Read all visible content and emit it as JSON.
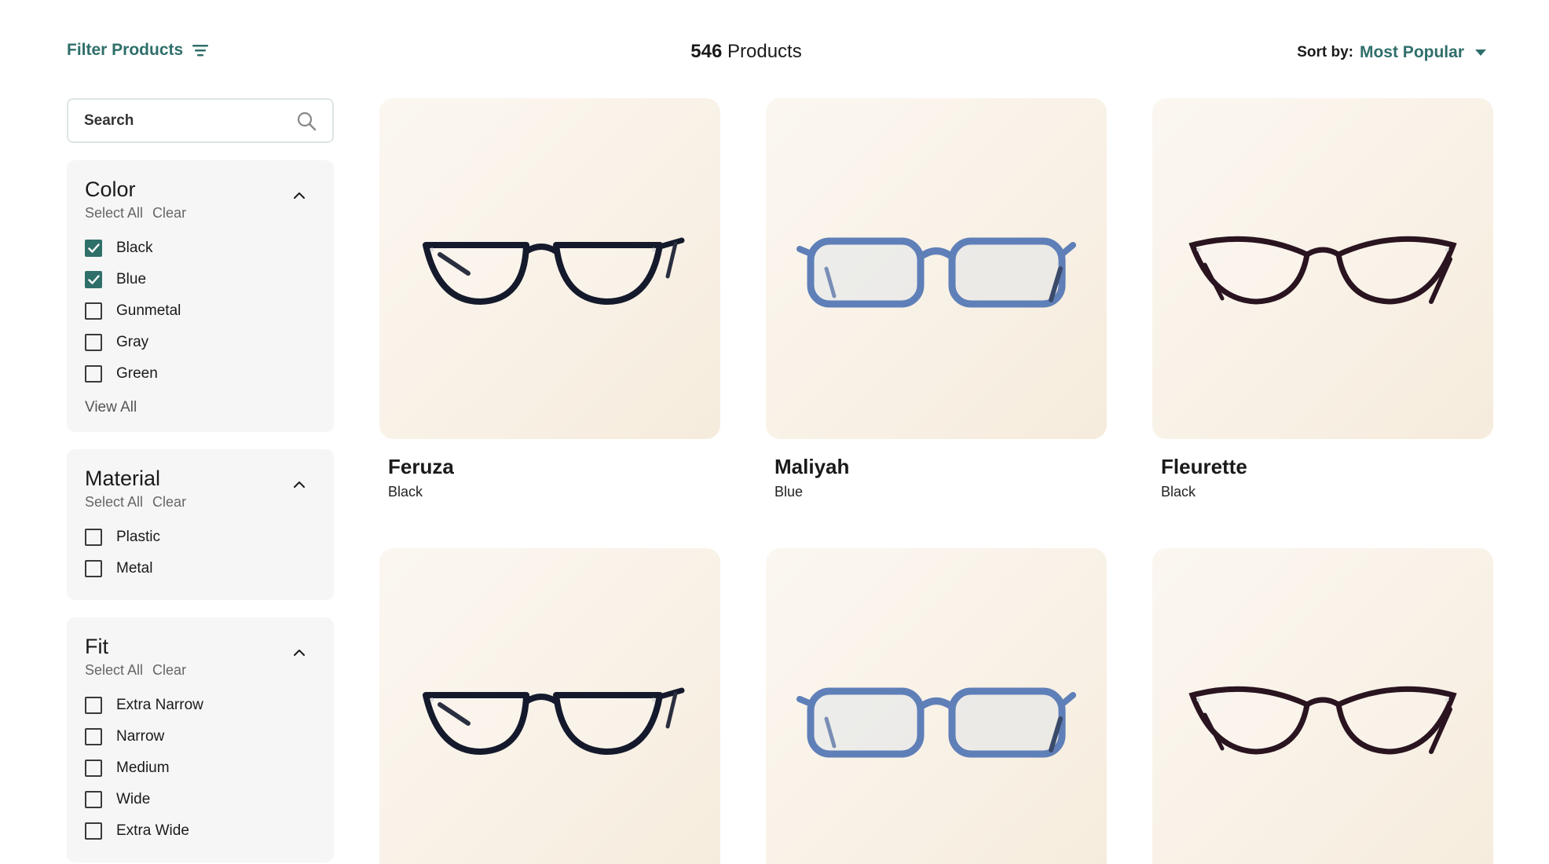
{
  "header": {
    "filter_label": "Filter Products",
    "count_number": "546",
    "count_suffix": "Products",
    "sort_label": "Sort by:",
    "sort_value": "Most Popular"
  },
  "search": {
    "placeholder": "Search"
  },
  "filters": [
    {
      "title": "Color",
      "select_all": "Select All",
      "clear": "Clear",
      "options": [
        {
          "label": "Black",
          "checked": true
        },
        {
          "label": "Blue",
          "checked": true
        },
        {
          "label": "Gunmetal",
          "checked": false
        },
        {
          "label": "Gray",
          "checked": false
        },
        {
          "label": "Green",
          "checked": false
        }
      ],
      "view_all": "View All"
    },
    {
      "title": "Material",
      "select_all": "Select All",
      "clear": "Clear",
      "options": [
        {
          "label": "Plastic",
          "checked": false
        },
        {
          "label": "Metal",
          "checked": false
        }
      ]
    },
    {
      "title": "Fit",
      "select_all": "Select All",
      "clear": "Clear",
      "options": [
        {
          "label": "Extra Narrow",
          "checked": false
        },
        {
          "label": "Narrow",
          "checked": false
        },
        {
          "label": "Medium",
          "checked": false
        },
        {
          "label": "Wide",
          "checked": false
        },
        {
          "label": "Extra Wide",
          "checked": false
        }
      ]
    }
  ],
  "products": [
    {
      "name": "Feruza",
      "color": "Black",
      "frame": "black"
    },
    {
      "name": "Maliyah",
      "color": "Blue",
      "frame": "blue"
    },
    {
      "name": "Fleurette",
      "color": "Black",
      "frame": "cateye"
    },
    {
      "name": "",
      "color": "",
      "frame": "black"
    },
    {
      "name": "",
      "color": "",
      "frame": "blue"
    },
    {
      "name": "",
      "color": "",
      "frame": "cateye"
    }
  ],
  "colors": {
    "accent": "#2f6f6a",
    "panel_bg": "#f6f6f6",
    "card_bg_start": "#fbf7f1",
    "card_bg_end": "#f6ecdd"
  }
}
